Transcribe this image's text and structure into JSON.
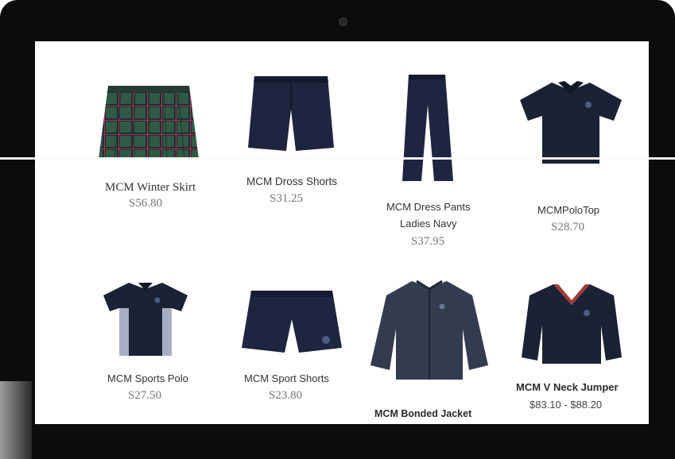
{
  "products": [
    {
      "name": "MCM Winter Skirt",
      "price": "S56.80",
      "image": "tartan-skirt"
    },
    {
      "name": "MCM Dross Shorts",
      "price": "S31.25",
      "image": "navy-shorts"
    },
    {
      "name_line1": "MCM Dress Pants",
      "name_line2": "Ladies Navy",
      "price": "S37.95",
      "image": "navy-pants"
    },
    {
      "name": "MCMPoloTop",
      "price": "S28.70",
      "image": "navy-polo"
    },
    {
      "name": "MCM Sports Polo",
      "price": "S27.50",
      "image": "sports-polo"
    },
    {
      "name": "MCM Sport Shorts",
      "price": "S23.80",
      "image": "sport-shorts"
    },
    {
      "name": "MCM Bonded Jacket",
      "image": "bonded-jacket"
    },
    {
      "name": "MCM V Neck Jumper",
      "price": "$83.10 - $88.20",
      "image": "v-neck-jumper"
    }
  ],
  "colors": {
    "bezel": "#0c0c0c",
    "navy": "#1d2540",
    "tartan_green": "#2f5a45",
    "text": "#333333",
    "price": "#777777"
  }
}
